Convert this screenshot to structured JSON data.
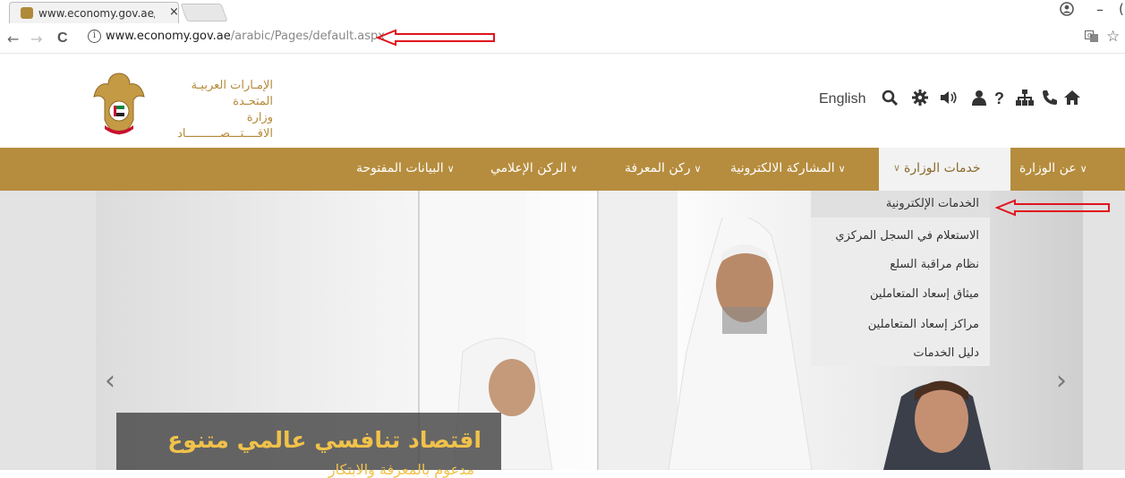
{
  "browser": {
    "tab_title": "www.economy.gov.ae/ar",
    "tab_close": "×",
    "url_host": "www.economy.gov.ae",
    "url_path": "/arabic/Pages/default.aspx",
    "back": "←",
    "forward": "→",
    "reload": "C",
    "info": "i",
    "min": "–",
    "clip": "(",
    "icons": [
      "tab-favicon",
      "user-icon",
      "translate-icon",
      "star-icon"
    ]
  },
  "logo": {
    "line1": "الإمـارات العربيـة المتحـدة",
    "line2": "وزارة الاقــــتـــصــــــــــاد"
  },
  "utility": {
    "english": "English",
    "icons": [
      "search-icon",
      "gear-icon",
      "volume-icon",
      "user-icon",
      "question-icon",
      "sitemap-icon",
      "phone-icon",
      "home-icon"
    ]
  },
  "menu": {
    "items": [
      {
        "label": "عن الوزارة"
      },
      {
        "label": "خدمات الوزارة"
      },
      {
        "label": "المشاركة الالكترونية"
      },
      {
        "label": "ركن المعرفة"
      },
      {
        "label": "الركن الإعلامي"
      },
      {
        "label": "البيانات المفتوحة"
      }
    ],
    "chevron": "∨"
  },
  "dropdown": {
    "items": [
      {
        "label": "الخدمات الإلكترونية"
      },
      {
        "label": "الاستعلام في السجل المركزي"
      },
      {
        "label": "نظام مراقبة السلع"
      },
      {
        "label": "ميثاق إسعاد المتعاملين"
      },
      {
        "label": "مراكز إسعاد المتعاملين"
      },
      {
        "label": "دليل الخدمات"
      }
    ]
  },
  "hero": {
    "caption_title": "اقتصاد تنافسي عالمي متنوع",
    "caption_sub": "مدعوم بالمعرفة والابتكار",
    "prev": "‹",
    "next": "›"
  },
  "colors": {
    "nav_gold": "#b68d3e",
    "logo_gold": "#b58a3a",
    "caption_text": "#f1c24a",
    "annotation_red": "#e0141e"
  }
}
